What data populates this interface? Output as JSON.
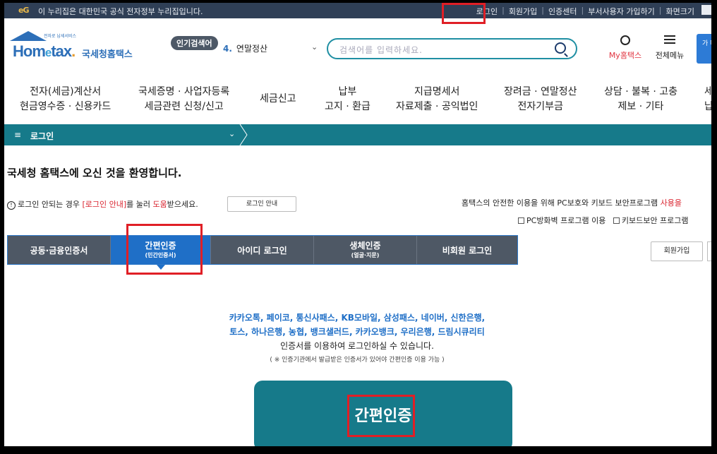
{
  "gov_bar": {
    "logo_text": "eG",
    "notice": "이 누리집은 대한민국 공식 전자정부 누리집입니다.",
    "links": [
      "로그인",
      "회원가입",
      "인증센터",
      "부서사용자 가입하기",
      "화면크기"
    ]
  },
  "header": {
    "logo_sub": "전자로 납세서비스",
    "logo_home": "Hom",
    "logo_e": "e",
    "logo_tax": "tax",
    "logo_dot": ".",
    "logo_kname": "국세청홈택스",
    "popular_badge": "인기검색어",
    "popular_rank": "4.",
    "popular_term": "연말정산",
    "search_placeholder": "검색어를 입력하세요.",
    "my_home": "My홈택스",
    "all_menu": "전체메뉴",
    "right_box": "가 마"
  },
  "gnb": [
    {
      "line1": "전자(세금)계산서",
      "line2": "현금영수증 · 신용카드"
    },
    {
      "line1": "국세증명 · 사업자등록",
      "line2": "세금관련 신청/신고"
    },
    {
      "line1": "세금신고",
      "line2": ""
    },
    {
      "line1": "납부",
      "line2": "고지 · 환급"
    },
    {
      "line1": "지급명세서",
      "line2": "자료제출 · 공익법인"
    },
    {
      "line1": "장려금 · 연말정산",
      "line2": "전자기부금"
    },
    {
      "line1": "상담 · 불복 · 고충",
      "line2": "제보 · 기타"
    },
    {
      "line1": "세",
      "line2": "납"
    }
  ],
  "breadcrumb": {
    "menu_icon": "≡",
    "title": "로그인",
    "chevron": "⌄"
  },
  "welcome": "국세청 홈택스에 오신 것을 환영합니다.",
  "help": {
    "prefix": "로그인 안되는 경우 ",
    "link": "[로그인 안내]",
    "middle": "를 눌러 ",
    "highlight": "도움",
    "suffix": "받으세요.",
    "button": "로그인 안내"
  },
  "security": {
    "text": "홈택스의 안전한 이용을 위해 PC보호와 키보드 보안프로그램 ",
    "red": "사용을",
    "check1": "PC방화벽 프로그램 이용",
    "check2": "키보드보안 프로그램"
  },
  "tabs": [
    {
      "label": "공동·금융인증서",
      "sub": ""
    },
    {
      "label": "간편인증",
      "sub": "(민간인증서)"
    },
    {
      "label": "아이디 로그인",
      "sub": ""
    },
    {
      "label": "생체인증",
      "sub": "(얼굴·지문)"
    },
    {
      "label": "비회원 로그인",
      "sub": ""
    }
  ],
  "join_button": "회원가입",
  "providers": {
    "line1": "카카오톡, 페이코, 통신사패스, KB모바일, 삼성패스, 네이버, 신한은행,",
    "line2": "토스, 하나은행, 농협, 뱅크샐러드, 카카오뱅크, 우리은행, 드림시큐리티",
    "line3": "인증서를 이용하여 로그인하실 수 있습니다.",
    "note": "( ※ 인증기관에서 발급받은 인증서가 있어야 간편인증 이용 가능 )"
  },
  "big_button": "간편인증",
  "colors": {
    "teal": "#167a8a",
    "blue": "#1f6fc7",
    "tab_gray": "#4e5865",
    "highlight": "#e01f26"
  }
}
